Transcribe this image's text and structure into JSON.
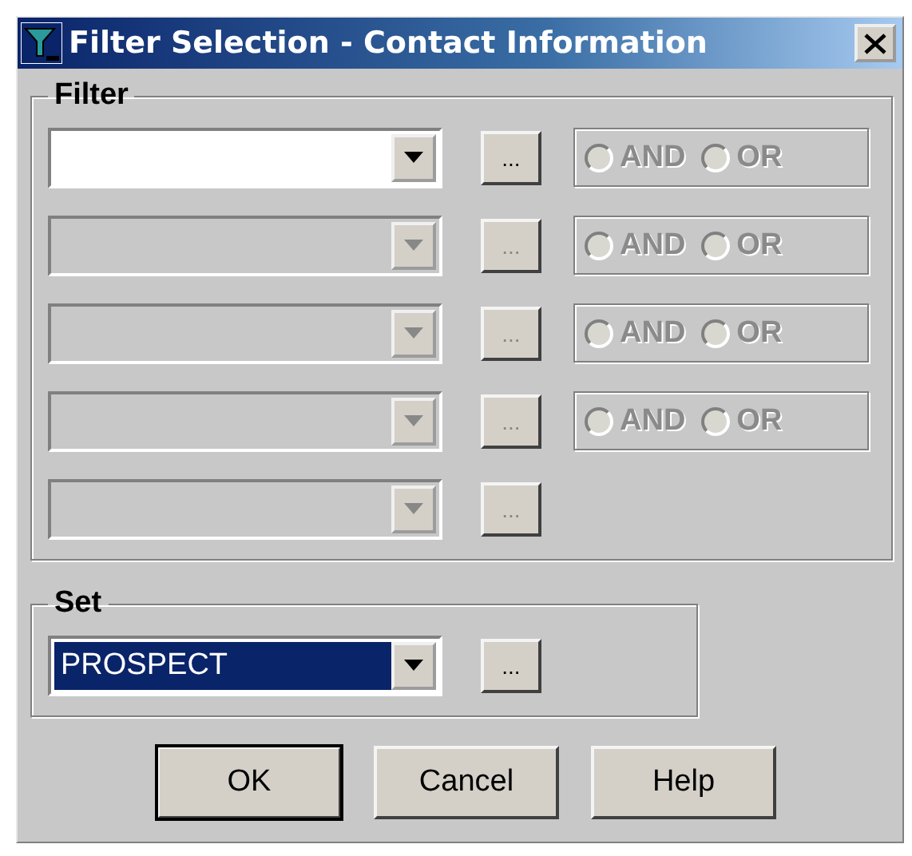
{
  "window": {
    "title": "Filter Selection - Contact Information"
  },
  "filter": {
    "label": "Filter",
    "rows": [
      {
        "disabled": false,
        "button": "...",
        "operator": {
          "disabled": true,
          "options": [
            {
              "label": "AND",
              "selected": false
            },
            {
              "label": "OR",
              "selected": false
            }
          ]
        }
      },
      {
        "disabled": true,
        "button": "...",
        "operator": {
          "disabled": true,
          "options": [
            {
              "label": "AND",
              "selected": false
            },
            {
              "label": "OR",
              "selected": false
            }
          ]
        }
      },
      {
        "disabled": true,
        "button": "...",
        "operator": {
          "disabled": true,
          "options": [
            {
              "label": "AND",
              "selected": false
            },
            {
              "label": "OR",
              "selected": false
            }
          ]
        }
      },
      {
        "disabled": true,
        "button": "...",
        "operator": {
          "disabled": true,
          "options": [
            {
              "label": "AND",
              "selected": false
            },
            {
              "label": "OR",
              "selected": false
            }
          ]
        }
      },
      {
        "disabled": true,
        "button": "..."
      }
    ]
  },
  "set": {
    "label": "Set",
    "value": "PROSPECT",
    "focused": true,
    "button": "..."
  },
  "buttons": [
    {
      "label": "OK",
      "default": true
    },
    {
      "label": "Cancel",
      "default": false
    },
    {
      "label": "Help",
      "default": false
    }
  ]
}
